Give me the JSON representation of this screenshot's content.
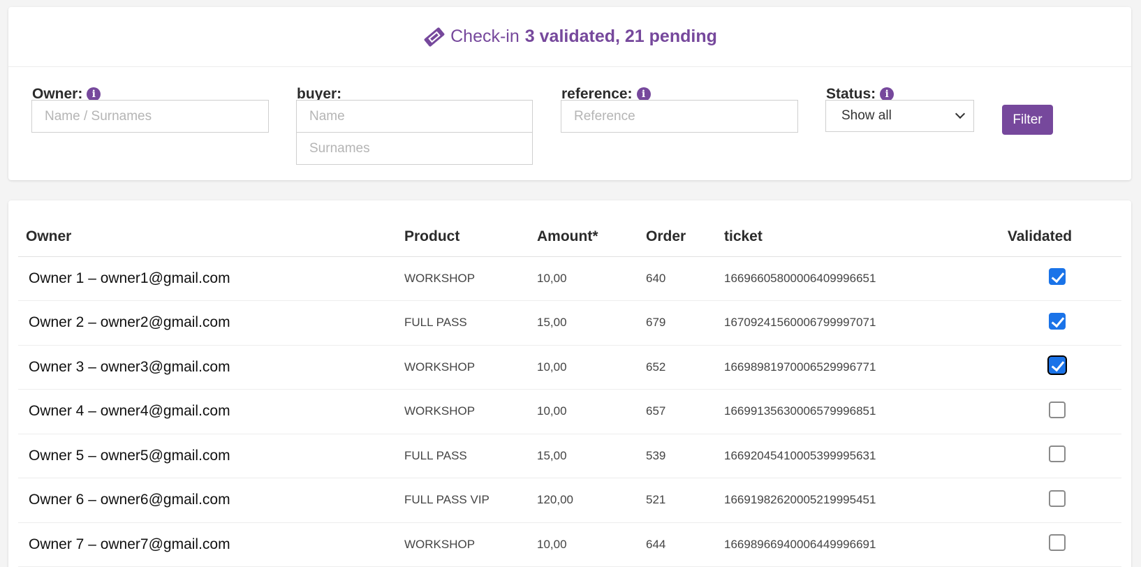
{
  "header": {
    "icon": "ticket-icon",
    "title": "Check-in",
    "summary": "3 validated, 21 pending",
    "accent_color": "#76489c"
  },
  "filters": {
    "owner": {
      "label": "Owner:",
      "placeholder": "Name / Surnames",
      "value": ""
    },
    "buyer": {
      "label": "buyer:",
      "name_placeholder": "Name",
      "surnames_placeholder": "Surnames"
    },
    "reference": {
      "label": "reference:",
      "placeholder": "Reference"
    },
    "status": {
      "label": "Status:",
      "selected": "Show all"
    },
    "filter_button": "Filter"
  },
  "table": {
    "columns": [
      "Owner",
      "Product",
      "Amount*",
      "Order",
      "ticket",
      "Validated"
    ],
    "rows": [
      {
        "owner": "Owner 1 – owner1@gmail.com",
        "product": "WORKSHOP",
        "amount": "10,00",
        "order": "640",
        "ticket": "16696605800006409996651",
        "validated": true
      },
      {
        "owner": "Owner 2 – owner2@gmail.com",
        "product": "FULL PASS",
        "amount": "15,00",
        "order": "679",
        "ticket": "16709241560006799997071",
        "validated": true
      },
      {
        "owner": "Owner 3 – owner3@gmail.com",
        "product": "WORKSHOP",
        "amount": "10,00",
        "order": "652",
        "ticket": "16698981970006529996771",
        "validated": true
      },
      {
        "owner": "Owner 4 – owner4@gmail.com",
        "product": "WORKSHOP",
        "amount": "10,00",
        "order": "657",
        "ticket": "16699135630006579996851",
        "validated": false
      },
      {
        "owner": "Owner 5 – owner5@gmail.com",
        "product": "FULL PASS",
        "amount": "15,00",
        "order": "539",
        "ticket": "16692045410005399995631",
        "validated": false
      },
      {
        "owner": "Owner 6 – owner6@gmail.com",
        "product": "FULL PASS VIP",
        "amount": "120,00",
        "order": "521",
        "ticket": "16691982620005219995451",
        "validated": false
      },
      {
        "owner": "Owner 7 – owner7@gmail.com",
        "product": "WORKSHOP",
        "amount": "10,00",
        "order": "644",
        "ticket": "16698966940006449996691",
        "validated": false
      }
    ]
  }
}
